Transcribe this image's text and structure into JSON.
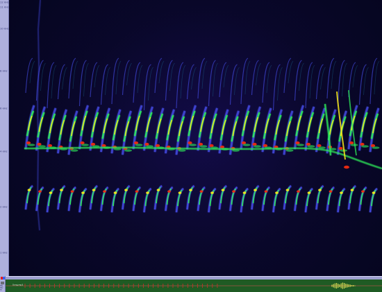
{
  "window": {
    "title": ""
  },
  "frequency_axis": {
    "labels": [
      {
        "id": "hz_top",
        "text": "12 kHz"
      },
      {
        "id": "hz_a",
        "text": "11 kHz"
      },
      {
        "id": "hz_b",
        "text": "10 kHz"
      },
      {
        "id": "hz_c",
        "text": "8 kHz"
      },
      {
        "id": "hz_d",
        "text": "6 kHz"
      },
      {
        "id": "hz_e",
        "text": "4 kHz"
      },
      {
        "id": "hz_f",
        "text": "2 kHz"
      },
      {
        "id": "hz_g",
        "text": "1 kHz"
      }
    ]
  },
  "spectrogram": {
    "left_top_note": "",
    "bottom_right_note": "",
    "accent": "#f02b10",
    "colors": {
      "background_dark": "#05051f",
      "blue": "#4d55ff",
      "cyan": "#28d8ff",
      "green": "#2ef05a",
      "yellow": "#f7ea19",
      "red": "#f02b10"
    }
  },
  "timeline": {
    "labels": [
      {
        "id": "t0",
        "text": "0.0"
      },
      {
        "id": "t1",
        "text": "0.2"
      },
      {
        "id": "t2",
        "text": "0.4"
      },
      {
        "id": "t3",
        "text": "0.6"
      },
      {
        "id": "t4",
        "text": "0.8"
      },
      {
        "id": "t5",
        "text": "1.0"
      },
      {
        "id": "t6",
        "text": "1.2"
      },
      {
        "id": "t7",
        "text": "1.4"
      },
      {
        "id": "t8",
        "text": "1.6"
      },
      {
        "id": "t9",
        "text": "1.8"
      },
      {
        "id": "t10",
        "text": "2.0"
      },
      {
        "id": "t11",
        "text": "2.2"
      },
      {
        "id": "t12",
        "text": "2.4"
      },
      {
        "id": "t13",
        "text": "2.6"
      },
      {
        "id": "t14",
        "text": "2.8"
      },
      {
        "id": "t15",
        "text": "3.0"
      },
      {
        "id": "t16",
        "text": "3.2"
      },
      {
        "id": "t17",
        "text": "3.4"
      },
      {
        "id": "t18",
        "text": "3.6"
      },
      {
        "id": "t19",
        "text": "3.8"
      },
      {
        "id": "t20",
        "text": "4.0"
      },
      {
        "id": "t21",
        "text": "4.2"
      }
    ],
    "overview_caption": "Song.mp3",
    "left_panel_lines": [
      "db1",
      "db2",
      "lvl",
      "rate"
    ]
  }
}
